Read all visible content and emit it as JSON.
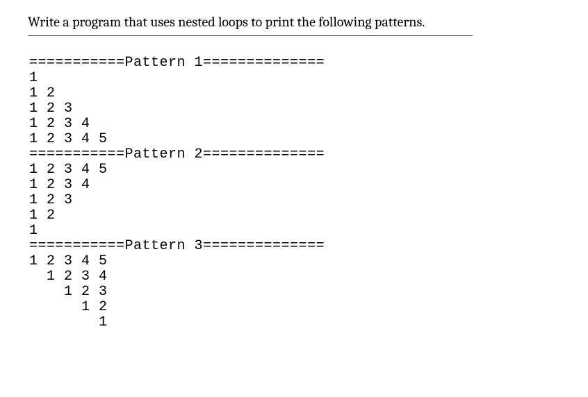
{
  "prompt": "Write a program that uses nested loops to print the following patterns.",
  "output": {
    "header1": "===========Pattern 1==============",
    "p1_l1": "1",
    "p1_l2": "1 2",
    "p1_l3": "1 2 3",
    "p1_l4": "1 2 3 4",
    "p1_l5": "1 2 3 4 5",
    "header2": "===========Pattern 2==============",
    "p2_l1": "1 2 3 4 5",
    "p2_l2": "1 2 3 4",
    "p2_l3": "1 2 3",
    "p2_l4": "1 2",
    "p2_l5": "1",
    "header3": "===========Pattern 3==============",
    "p3_l1": "1 2 3 4 5",
    "p3_l2": "  1 2 3 4",
    "p3_l3": "    1 2 3",
    "p3_l4": "      1 2",
    "p3_l5": "        1"
  }
}
